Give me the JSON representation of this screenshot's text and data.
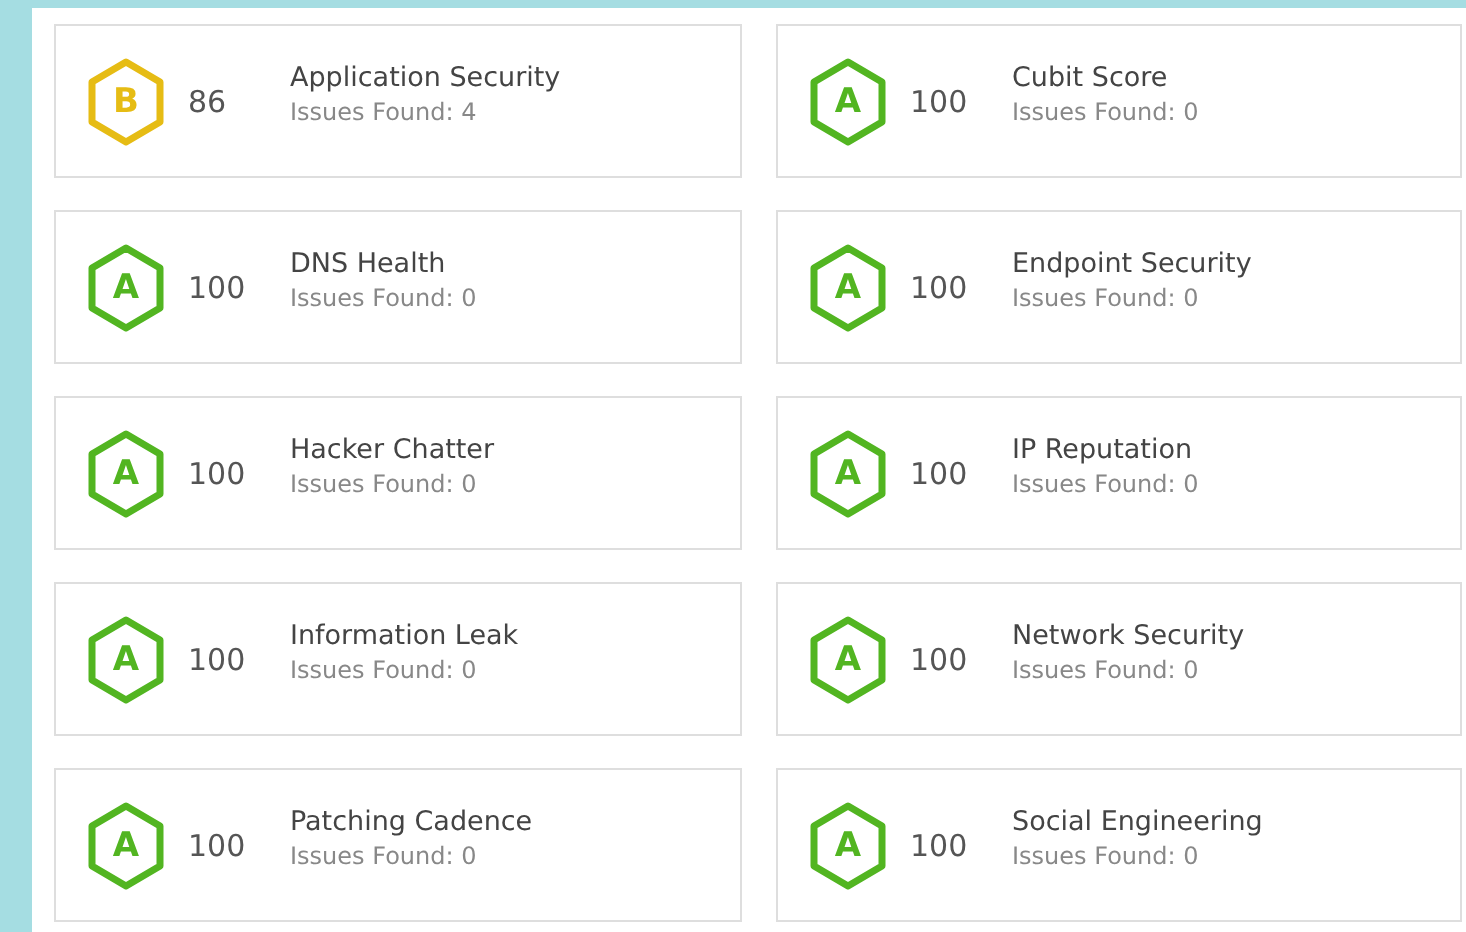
{
  "categories": [
    {
      "grade": "B",
      "color": "#e6bc14",
      "score": "86",
      "name": "Application Security",
      "issues": "Issues Found: 4"
    },
    {
      "grade": "A",
      "color": "#52b521",
      "score": "100",
      "name": "Cubit Score",
      "issues": "Issues Found: 0"
    },
    {
      "grade": "A",
      "color": "#52b521",
      "score": "100",
      "name": "DNS Health",
      "issues": "Issues Found: 0"
    },
    {
      "grade": "A",
      "color": "#52b521",
      "score": "100",
      "name": "Endpoint Security",
      "issues": "Issues Found: 0"
    },
    {
      "grade": "A",
      "color": "#52b521",
      "score": "100",
      "name": "Hacker Chatter",
      "issues": "Issues Found: 0"
    },
    {
      "grade": "A",
      "color": "#52b521",
      "score": "100",
      "name": "IP Reputation",
      "issues": "Issues Found: 0"
    },
    {
      "grade": "A",
      "color": "#52b521",
      "score": "100",
      "name": "Information Leak",
      "issues": "Issues Found: 0"
    },
    {
      "grade": "A",
      "color": "#52b521",
      "score": "100",
      "name": "Network Security",
      "issues": "Issues Found: 0"
    },
    {
      "grade": "A",
      "color": "#52b521",
      "score": "100",
      "name": "Patching Cadence",
      "issues": "Issues Found: 0"
    },
    {
      "grade": "A",
      "color": "#52b521",
      "score": "100",
      "name": "Social Engineering",
      "issues": "Issues Found: 0"
    }
  ]
}
